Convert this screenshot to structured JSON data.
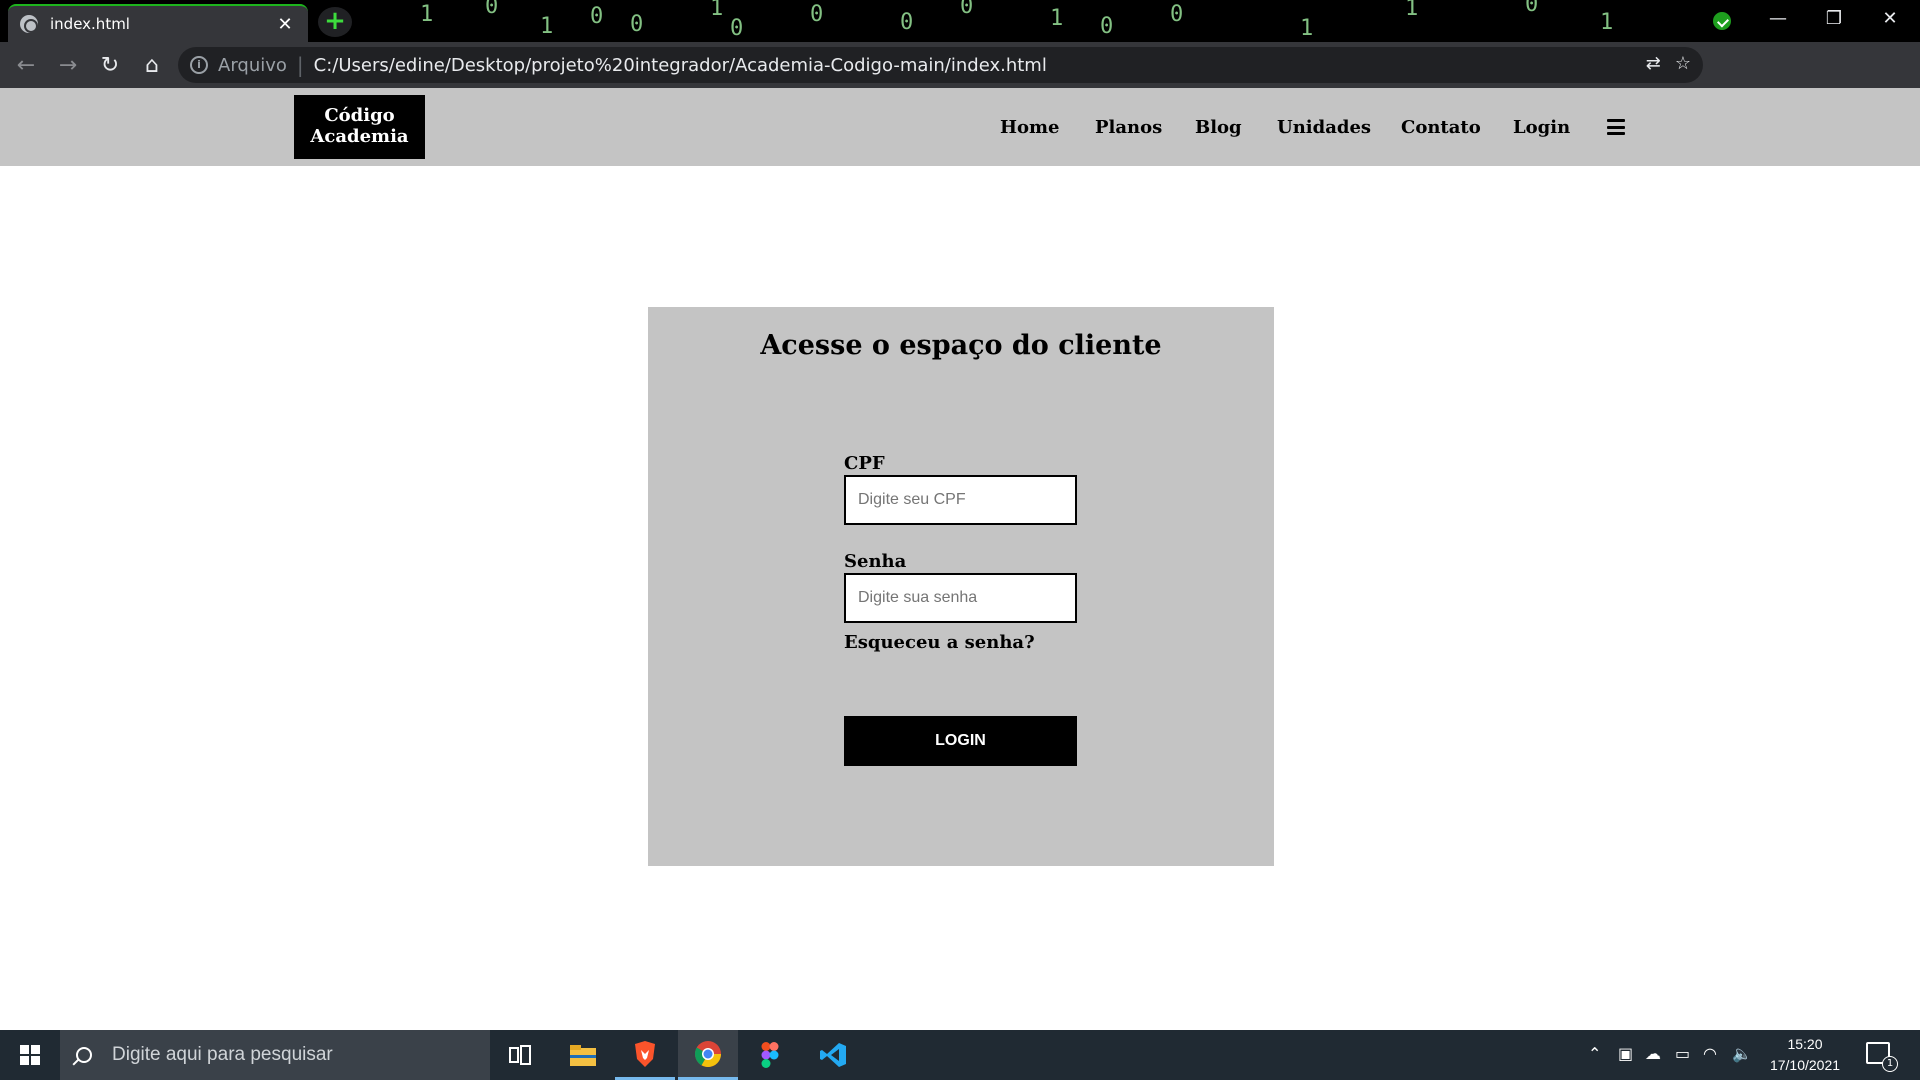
{
  "browser": {
    "tab_title": "index.html",
    "tab_close": "✕",
    "new_tab": "+",
    "address_scheme": "Arquivo",
    "address_separator": "|",
    "address_url": "C:/Users/edine/Desktop/projeto%20integrador/Academia-Codigo-main/index.html",
    "window_controls": {
      "minimize": "—",
      "restore": "❐",
      "close": "✕"
    },
    "nav_back": "←",
    "nav_forward": "→",
    "nav_reload": "↻",
    "nav_home": "⌂"
  },
  "site": {
    "logo_line1": "Código",
    "logo_line2": "Academia",
    "nav": [
      "Home",
      "Planos",
      "Blog",
      "Unidades",
      "Contato",
      "Login"
    ]
  },
  "login": {
    "title": "Acesse o espaço do cliente",
    "cpf_label": "CPF",
    "cpf_placeholder": "Digite seu CPF",
    "password_label": "Senha",
    "password_placeholder": "Digite sua senha",
    "forgot": "Esqueceu a senha?",
    "button": "LOGIN"
  },
  "taskbar": {
    "search_placeholder": "Digite aqui para pesquisar",
    "time": "15:20",
    "date": "17/10/2021",
    "notification_count": "1"
  },
  "colors": {
    "header_bg": "#c4c4c4",
    "card_bg": "#c4c4c4",
    "logo_bg": "#000000",
    "button_bg": "#000000",
    "taskbar_bg": "#202a33",
    "tab_accent": "#1db51d"
  },
  "icons": [
    "globe-icon",
    "close-icon",
    "plus-icon",
    "back-arrow-icon",
    "forward-arrow-icon",
    "reload-icon",
    "home-icon",
    "info-icon",
    "translate-icon",
    "star-icon",
    "metamask-icon",
    "pen-icon",
    "puzzle-icon",
    "avatar-icon",
    "kebab-menu-icon",
    "hamburger-icon",
    "windows-logo-icon",
    "search-icon",
    "task-view-icon",
    "file-explorer-icon",
    "brave-icon",
    "chrome-icon",
    "figma-icon",
    "vscode-icon"
  ]
}
